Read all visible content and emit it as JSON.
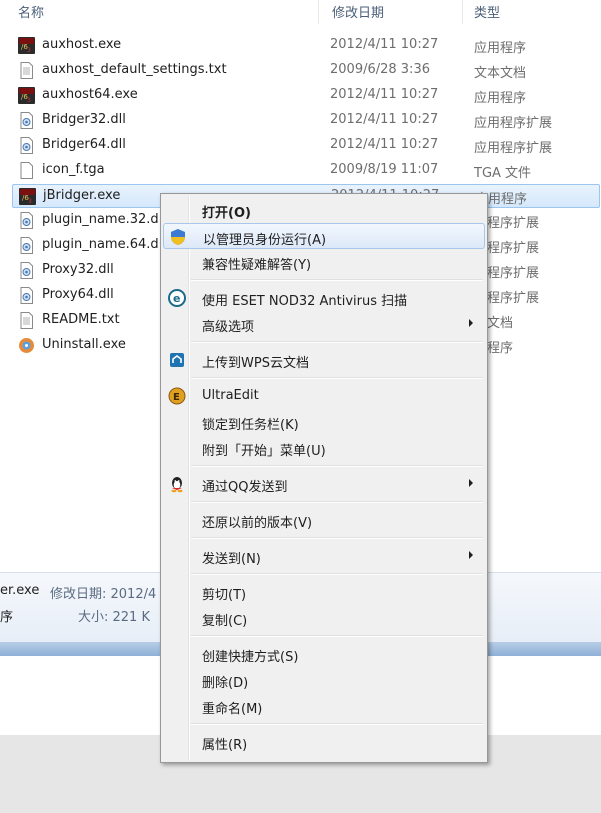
{
  "columns": {
    "name": "名称",
    "date": "修改日期",
    "type": "类型"
  },
  "files": [
    {
      "name": "auxhost.exe",
      "date": "2012/4/11 10:27",
      "type": "应用程序",
      "icon": "exe-icon"
    },
    {
      "name": "auxhost_default_settings.txt",
      "date": "2009/6/28 3:36",
      "type": "文本文档",
      "icon": "text-file-icon"
    },
    {
      "name": "auxhost64.exe",
      "date": "2012/4/11 10:27",
      "type": "应用程序",
      "icon": "exe-icon"
    },
    {
      "name": "Bridger32.dll",
      "date": "2012/4/11 10:27",
      "type": "应用程序扩展",
      "icon": "dll-icon"
    },
    {
      "name": "Bridger64.dll",
      "date": "2012/4/11 10:27",
      "type": "应用程序扩展",
      "icon": "dll-icon"
    },
    {
      "name": "icon_f.tga",
      "date": "2009/8/19 11:07",
      "type": "TGA 文件",
      "icon": "file-icon"
    },
    {
      "name": "jBridger.exe",
      "date": "2012/4/11 10:27",
      "type": "应用程序",
      "icon": "exe-icon"
    },
    {
      "name": "plugin_name.32.d",
      "date": "",
      "type": "用程序扩展",
      "icon": "dll-icon"
    },
    {
      "name": "plugin_name.64.d",
      "date": "",
      "type": "用程序扩展",
      "icon": "dll-icon"
    },
    {
      "name": "Proxy32.dll",
      "date": "",
      "type": "用程序扩展",
      "icon": "dll-icon"
    },
    {
      "name": "Proxy64.dll",
      "date": "",
      "type": "用程序扩展",
      "icon": "dll-icon"
    },
    {
      "name": "README.txt",
      "date": "",
      "type": "本文档",
      "icon": "text-file-icon"
    },
    {
      "name": "Uninstall.exe",
      "date": "",
      "type": "用程序",
      "icon": "uninstall-icon"
    }
  ],
  "details": {
    "name_fragment": "er.exe",
    "date_label": "修改日期: 2012/4",
    "type_fragment": "序",
    "size_label": "大小: 221 K"
  },
  "context_menu": [
    {
      "label": "打开(O)",
      "bold": true,
      "icon": ""
    },
    {
      "label": "以管理员身份运行(A)",
      "icon": "uac-shield-icon",
      "hover": true
    },
    {
      "label": "兼容性疑难解答(Y)",
      "icon": ""
    },
    {
      "separator": true
    },
    {
      "label": "使用 ESET NOD32 Antivirus 扫描",
      "icon": "eset-icon"
    },
    {
      "label": "高级选项",
      "icon": "",
      "submenu": true
    },
    {
      "separator": true
    },
    {
      "label": "上传到WPS云文档",
      "icon": "wps-cloud-icon"
    },
    {
      "separator": true
    },
    {
      "label": "UltraEdit",
      "icon": "ultraedit-icon"
    },
    {
      "label": "锁定到任务栏(K)",
      "icon": ""
    },
    {
      "label": "附到「开始」菜单(U)",
      "icon": ""
    },
    {
      "separator": true
    },
    {
      "label": "通过QQ发送到",
      "icon": "qq-penguin-icon",
      "submenu": true
    },
    {
      "separator": true
    },
    {
      "label": "还原以前的版本(V)",
      "icon": ""
    },
    {
      "separator": true
    },
    {
      "label": "发送到(N)",
      "icon": "",
      "submenu": true
    },
    {
      "separator": true
    },
    {
      "label": "剪切(T)",
      "icon": ""
    },
    {
      "label": "复制(C)",
      "icon": ""
    },
    {
      "separator": true
    },
    {
      "label": "创建快捷方式(S)",
      "icon": ""
    },
    {
      "label": "删除(D)",
      "icon": ""
    },
    {
      "label": "重命名(M)",
      "icon": ""
    },
    {
      "separator": true
    },
    {
      "label": "属性(R)",
      "icon": ""
    }
  ],
  "colors": {
    "selection": "#d5e8fc",
    "menu_bg": "#f0f0f0",
    "detail_bg": "#e7eef7"
  }
}
